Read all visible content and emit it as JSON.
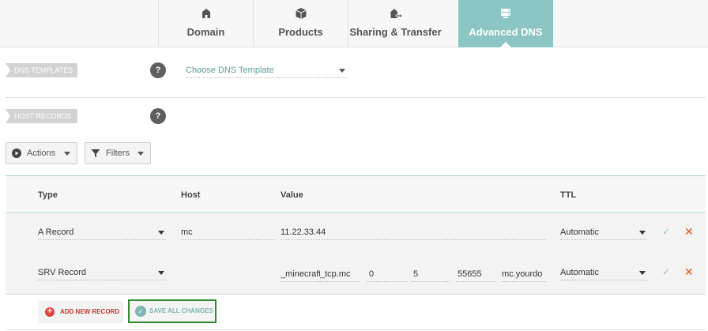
{
  "tabs": [
    {
      "label": "Domain",
      "icon": "home-icon",
      "active": false
    },
    {
      "label": "Products",
      "icon": "box-icon",
      "active": false
    },
    {
      "label": "Sharing & Transfer",
      "icon": "transfer-icon",
      "active": false
    },
    {
      "label": "Advanced DNS",
      "icon": "dns-server-icon",
      "active": true
    }
  ],
  "dns_templates": {
    "section_label": "DNS TEMPLATES",
    "help": "?",
    "select_value": "Choose DNS Template"
  },
  "host_records": {
    "section_label": "HOST RECORDS",
    "help": "?",
    "actions_label": "Actions",
    "filters_label": "Filters",
    "columns": {
      "type": "Type",
      "host": "Host",
      "value": "Value",
      "ttl": "TTL"
    },
    "rows": [
      {
        "type": "A Record",
        "host": "mc",
        "value": "11.22.33.44",
        "ttl": "Automatic"
      },
      {
        "type": "SRV Record",
        "service": "_minecraft",
        "protocol": "_tcp.mc",
        "priority": "0",
        "weight": "5",
        "port": "55655",
        "target": "mc.yourdo",
        "ttl": "Automatic"
      }
    ],
    "add_label": "ADD NEW RECORD",
    "save_label": "SAVE ALL CHANGES"
  },
  "colors": {
    "accent": "#8cc6c4",
    "delete": "#e2521b",
    "save_border": "#2e8b2e"
  }
}
